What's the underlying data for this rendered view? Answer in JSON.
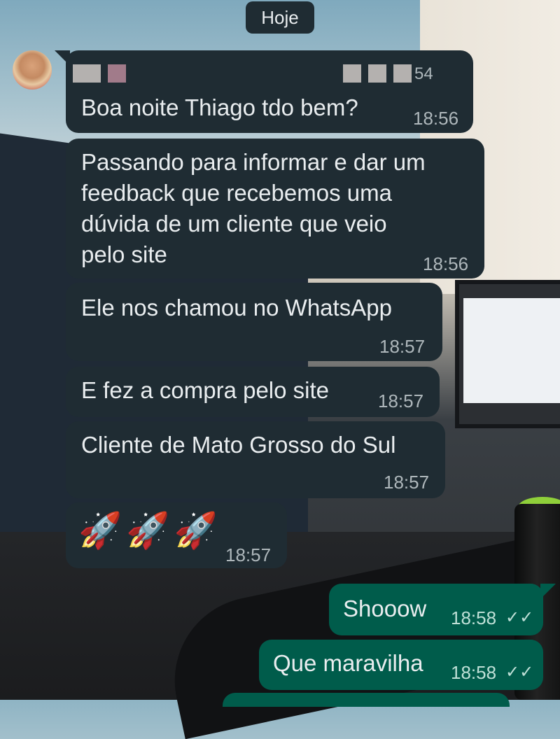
{
  "chat": {
    "date_label": "Hoje",
    "sender_suffix": "54",
    "messages": [
      {
        "dir": "in",
        "text": "Boa noite Thiago tdo bem?",
        "time": "18:56"
      },
      {
        "dir": "in",
        "text": "Passando para informar e dar um\nfeedback que recebemos uma\ndúvida de um cliente que veio\npelo site",
        "time": "18:56"
      },
      {
        "dir": "in",
        "text": "Ele nos chamou no WhatsApp",
        "time": "18:57"
      },
      {
        "dir": "in",
        "text": "E fez a compra pelo site",
        "time": "18:57"
      },
      {
        "dir": "in",
        "text": "Cliente de Mato Grosso do Sul",
        "time": "18:57"
      },
      {
        "dir": "in",
        "text": "🚀🚀🚀",
        "time": "18:57"
      },
      {
        "dir": "out",
        "text": "Shooow",
        "time": "18:58",
        "status": "read"
      },
      {
        "dir": "out",
        "text": "Que maravilha",
        "time": "18:58",
        "status": "read"
      }
    ],
    "read_ticks": "✓✓"
  },
  "colors": {
    "incoming_bubble": "#1f2c33",
    "outgoing_bubble": "#005c4b",
    "text": "#e9edef",
    "timestamp": "#aeb7bb"
  }
}
